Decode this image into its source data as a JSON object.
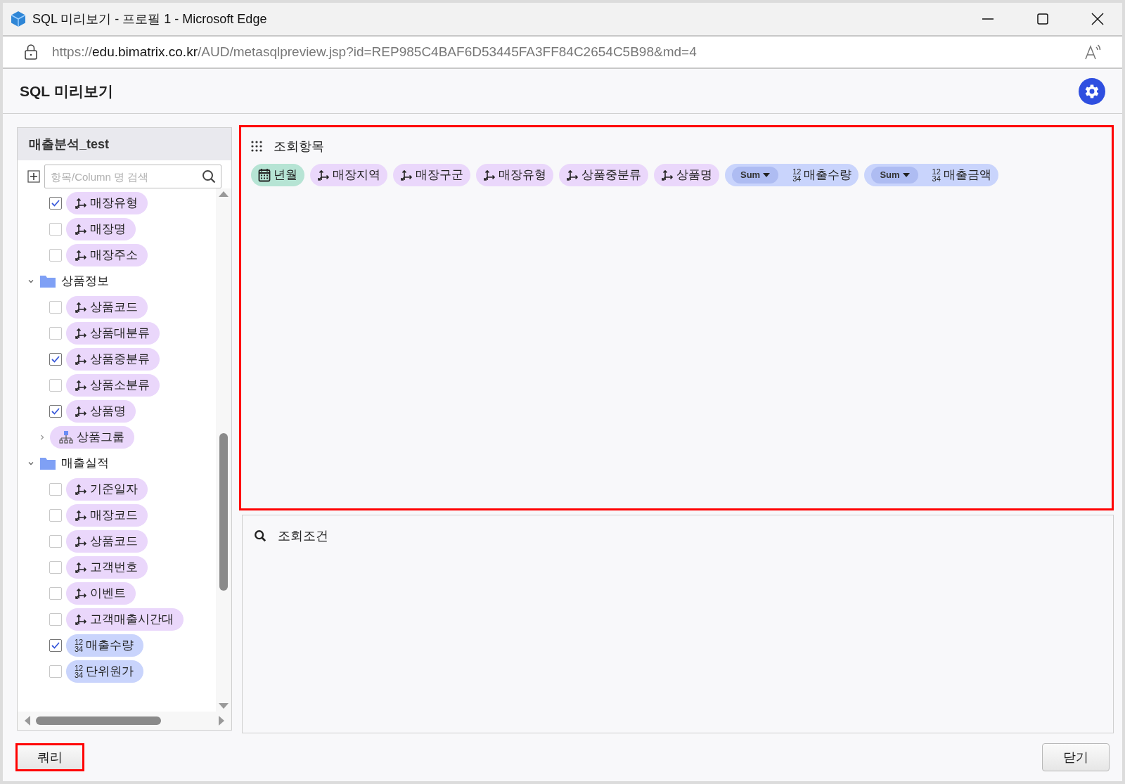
{
  "window": {
    "title": "SQL 미리보기 - 프로필 1 - Microsoft Edge"
  },
  "address_bar": {
    "scheme": "https://",
    "host": "edu.bimatrix.co.kr",
    "path": "/AUD/metasqlpreview.jsp?id=REP985C4BAF6D53445FA3FF84C2654C5B98&md=4"
  },
  "page": {
    "title": "SQL 미리보기"
  },
  "sidebar": {
    "title": "매출분석_test",
    "search": {
      "placeholder": "항목/Column 명 검색"
    },
    "tree": [
      {
        "kind": "dimension",
        "label": "매장유형",
        "checked": true
      },
      {
        "kind": "dimension",
        "label": "매장명",
        "checked": false
      },
      {
        "kind": "dimension",
        "label": "매장주소",
        "checked": false
      },
      {
        "kind": "folder",
        "label": "상품정보",
        "expanded": true,
        "children": [
          {
            "kind": "dimension",
            "label": "상품코드",
            "checked": false
          },
          {
            "kind": "dimension",
            "label": "상품대분류",
            "checked": false
          },
          {
            "kind": "dimension",
            "label": "상품중분류",
            "checked": true
          },
          {
            "kind": "dimension",
            "label": "상품소분류",
            "checked": false
          },
          {
            "kind": "dimension",
            "label": "상품명",
            "checked": true
          },
          {
            "kind": "hierarchy",
            "label": "상품그룹",
            "expanded": false
          }
        ]
      },
      {
        "kind": "folder",
        "label": "매출실적",
        "expanded": true,
        "children": [
          {
            "kind": "dimension",
            "label": "기준일자",
            "checked": false
          },
          {
            "kind": "dimension",
            "label": "매장코드",
            "checked": false
          },
          {
            "kind": "dimension",
            "label": "상품코드",
            "checked": false
          },
          {
            "kind": "dimension",
            "label": "고객번호",
            "checked": false
          },
          {
            "kind": "dimension",
            "label": "이벤트",
            "checked": false
          },
          {
            "kind": "dimension",
            "label": "고객매출시간대",
            "checked": false
          },
          {
            "kind": "measure",
            "label": "매출수량",
            "checked": true,
            "icon_digits": [
              "12",
              "34"
            ]
          },
          {
            "kind": "measure",
            "label": "단위원가",
            "checked": false,
            "icon_digits": [
              "12",
              "34"
            ]
          }
        ]
      }
    ]
  },
  "query_items": {
    "title": "조회항목",
    "highlighted": true,
    "items": [
      {
        "kind": "date",
        "label": "년월"
      },
      {
        "kind": "dimension",
        "label": "매장지역"
      },
      {
        "kind": "dimension",
        "label": "매장구군"
      },
      {
        "kind": "dimension",
        "label": "매장유형"
      },
      {
        "kind": "dimension",
        "label": "상품중분류"
      },
      {
        "kind": "dimension",
        "label": "상품명"
      },
      {
        "kind": "measure",
        "label": "매출수량",
        "aggregate": "Sum",
        "icon_digits": [
          "12",
          "34"
        ]
      },
      {
        "kind": "measure",
        "label": "매출금액",
        "aggregate": "Sum",
        "icon_digits": [
          "12",
          "34"
        ]
      }
    ]
  },
  "query_conditions": {
    "title": "조회조건",
    "highlighted": false
  },
  "buttons": [
    {
      "label": "쿼리",
      "highlighted": true
    },
    {
      "label": "닫기",
      "highlighted": false
    }
  ]
}
